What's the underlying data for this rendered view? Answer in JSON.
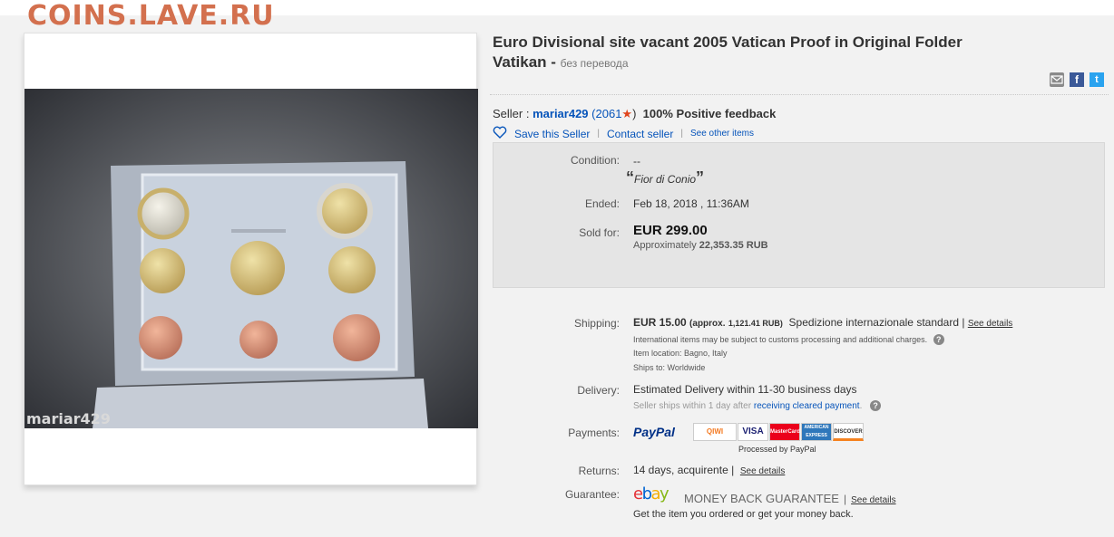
{
  "watermark": "COINS.LAVE.RU",
  "listing": {
    "title_line1": "Euro Divisional site vacant 2005 Vatican Proof in Original Folder",
    "title_line2": "Vatikan -",
    "title_note": "без перевода",
    "photo_watermark": "mariar429"
  },
  "seller": {
    "label": "Seller :",
    "name": "mariar429",
    "score": "(2061",
    "score_close": ")",
    "feedback": "100% Positive feedback",
    "save": "Save this Seller",
    "contact": "Contact seller",
    "other": "See other items"
  },
  "summary": {
    "condition_label": "Condition:",
    "condition_value": "--",
    "condition_quote": "Fior di Conio",
    "ended_label": "Ended:",
    "ended_value": "Feb 18, 2018 , 11:36AM",
    "sold_label": "Sold for:",
    "sold_value": "EUR 299.00",
    "approx_label": "Approximately",
    "approx_value": "22,353.35 RUB"
  },
  "shipping": {
    "label": "Shipping:",
    "price": "EUR 15.00",
    "approx": "(approx.",
    "approx_value": "1,121.41 RUB)",
    "method": "Spedizione internazionale standard |",
    "see": "See details",
    "note1": "International items may be subject to customs processing and additional charges.",
    "note2": "Item location:  Bagno, Italy",
    "note3": "Ships to:  Worldwide"
  },
  "delivery": {
    "label": "Delivery:",
    "value": "Estimated Delivery within 11-30 business days",
    "note_prefix": "Seller ships within 1 day after",
    "note_link": "receiving cleared payment",
    "note_suffix": "."
  },
  "payments": {
    "label": "Payments:",
    "paypal": "PayPal",
    "processed": "Processed by PayPal",
    "cards": [
      "QIWI",
      "VISA",
      "MasterCard",
      "AMERICAN EXPRESS",
      "DISCOVER"
    ]
  },
  "returns": {
    "label": "Returns:",
    "value": "14 days, acquirente |",
    "see": "See details"
  },
  "guarantee": {
    "label": "Guarantee:",
    "logo": "ebay",
    "mbg": "MONEY BACK GUARANTEE",
    "sep": "|",
    "see": "See details",
    "tagline": "Get the item you ordered or get your money back."
  },
  "colors": {
    "accent": "#0654ba",
    "watermark": "#d3704e",
    "ebay_e": "#e53238",
    "ebay_b": "#0064d2",
    "ebay_a": "#f5af02",
    "ebay_y": "#86b817"
  }
}
